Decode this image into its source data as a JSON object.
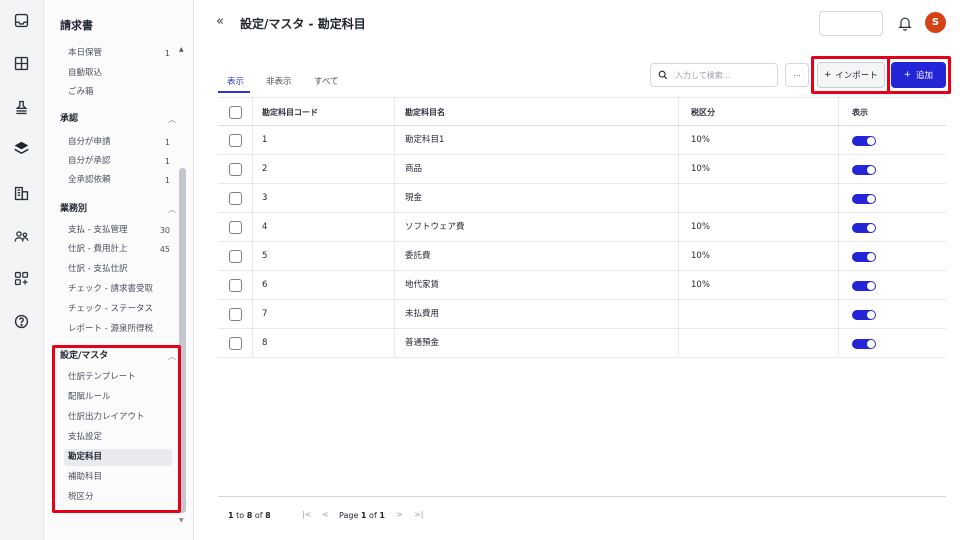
{
  "sidebar": {
    "title": "請求書",
    "top_items": [
      {
        "label": "本日保管",
        "count": "1"
      },
      {
        "label": "自動取込",
        "count": ""
      },
      {
        "label": "ごみ箱",
        "count": ""
      }
    ],
    "sections": [
      {
        "label": "承認",
        "items": [
          {
            "label": "自分が申請",
            "count": "1"
          },
          {
            "label": "自分が承認",
            "count": "1"
          },
          {
            "label": "全承認依頼",
            "count": "1"
          }
        ]
      },
      {
        "label": "業務別",
        "items": [
          {
            "label": "支払 - 支払管理",
            "count": "30"
          },
          {
            "label": "仕訳 - 費用計上",
            "count": "45"
          },
          {
            "label": "仕訳 - 支払仕訳",
            "count": ""
          },
          {
            "label": "チェック - 請求書受取",
            "count": ""
          },
          {
            "label": "チェック - ステータス",
            "count": ""
          },
          {
            "label": "レポート - 源泉所得税",
            "count": ""
          }
        ]
      },
      {
        "label": "設定/マスタ",
        "items": [
          {
            "label": "仕訳テンプレート"
          },
          {
            "label": "配賦ルール"
          },
          {
            "label": "仕訳出力レイアウト"
          },
          {
            "label": "支払設定"
          },
          {
            "label": "勘定科目"
          },
          {
            "label": "補助科目"
          },
          {
            "label": "税区分"
          }
        ]
      }
    ]
  },
  "header": {
    "title": "設定/マスタ - 勘定科目",
    "avatar": "S"
  },
  "tabs": [
    "表示",
    "非表示",
    "すべて"
  ],
  "toolbar": {
    "search_placeholder": "入力して検索...",
    "more_label": "...",
    "import_label": "インポート",
    "add_label": "追加"
  },
  "table": {
    "columns": [
      "勘定科目コード",
      "勘定科目名",
      "税区分",
      "表示"
    ],
    "rows": [
      {
        "code": "1",
        "name": "勘定科目1",
        "tax": "10%",
        "visible": true
      },
      {
        "code": "2",
        "name": "商品",
        "tax": "10%",
        "visible": true
      },
      {
        "code": "3",
        "name": "現金",
        "tax": "",
        "visible": true
      },
      {
        "code": "4",
        "name": "ソフトウェア費",
        "tax": "10%",
        "visible": true
      },
      {
        "code": "5",
        "name": "委託費",
        "tax": "10%",
        "visible": true
      },
      {
        "code": "6",
        "name": "地代家賃",
        "tax": "10%",
        "visible": true
      },
      {
        "code": "7",
        "name": "未払費用",
        "tax": "",
        "visible": true
      },
      {
        "code": "8",
        "name": "普通預金",
        "tax": "",
        "visible": true
      }
    ]
  },
  "pagination": {
    "from": "1",
    "to_label": "to",
    "to": "8",
    "of_label": "of",
    "total": "8",
    "page_label": "Page",
    "page": "1",
    "page_of_label": "of",
    "pages": "1"
  },
  "colors": {
    "accent": "#2525d8",
    "highlight": "#e6001a",
    "avatar": "#d64218"
  }
}
